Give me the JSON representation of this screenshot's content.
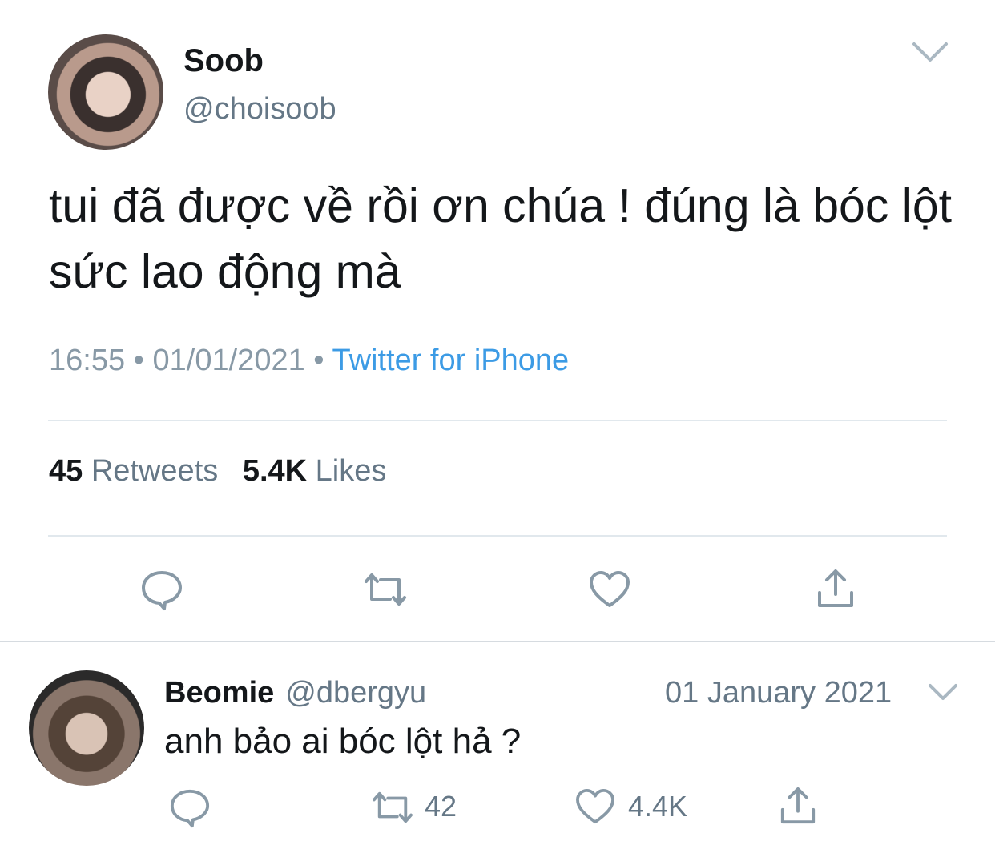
{
  "tweet": {
    "author": {
      "name": "Soob",
      "handle": "@choisoob",
      "avatar": "user-avatar"
    },
    "menu_icon": "chevron-down-icon",
    "text": "tui đã được về rồi ơn chúa ! đúng là bóc lột sức lao động mà",
    "time": "16:55",
    "date": "01/01/2021",
    "separator": "•",
    "source": "Twitter for iPhone",
    "stats": {
      "retweets_count": "45",
      "retweets_label": "Retweets",
      "likes_count": "5.4K",
      "likes_label": "Likes"
    },
    "actions": [
      "reply-icon",
      "retweet-icon",
      "like-icon",
      "share-icon"
    ]
  },
  "reply": {
    "author": {
      "name": "Beomie",
      "handle": "@dbergyu",
      "avatar": "user-avatar"
    },
    "date": "01 January 2021",
    "menu_icon": "chevron-down-icon",
    "text": "anh bảo ai bóc lột hả ?",
    "retweets": "42",
    "likes": "4.4K"
  },
  "colors": {
    "link": "#3c9be5",
    "muted": "#657786",
    "icon": "#8899a6",
    "text": "#14171a"
  }
}
